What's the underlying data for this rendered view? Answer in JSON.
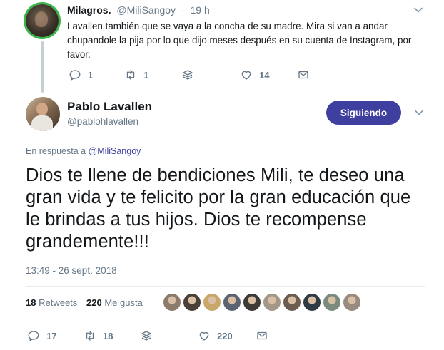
{
  "parent_tweet": {
    "name": "Milagros.",
    "handle": "@MiliSangoy",
    "separator": "·",
    "time": "19 h",
    "text": "Lavallen también que se vaya a la concha de su madre. Mira si van a andar chupandole la pija por lo que dijo meses después en su cuenta de Instagram, por favor.",
    "replies": "1",
    "retweets": "1",
    "likes": "14"
  },
  "main_tweet": {
    "name": "Pablo Lavallen",
    "handle": "@pablohlavallen",
    "follow_label": "Siguiendo",
    "reply_prefix": "En respuesta a",
    "reply_handle": "@MiliSangoy",
    "text": "Dios te llene de bendiciones Mili, te deseo una gran vida y te felicito por la gran educación que le brindas a tus hijos. Dios te recompense grandemente!!!",
    "date": "13:49 - 26 sept. 2018",
    "retweets_count": "18",
    "retweets_label": "Retweets",
    "likes_count": "220",
    "likes_label": "Me gusta",
    "replies": "17",
    "retweets": "18",
    "likes": "220"
  },
  "liker_avatars": [
    "#8c7b6b",
    "#4a4038",
    "#c9a76a",
    "#5b6470",
    "#3e3a36",
    "#a39887",
    "#6d5c50",
    "#2f3a44",
    "#7b8c7e",
    "#9a8b80"
  ],
  "colors": {
    "accent": "#3f3fa0",
    "muted": "#657786",
    "text": "#14171a",
    "online_ring": "#39b54a"
  }
}
